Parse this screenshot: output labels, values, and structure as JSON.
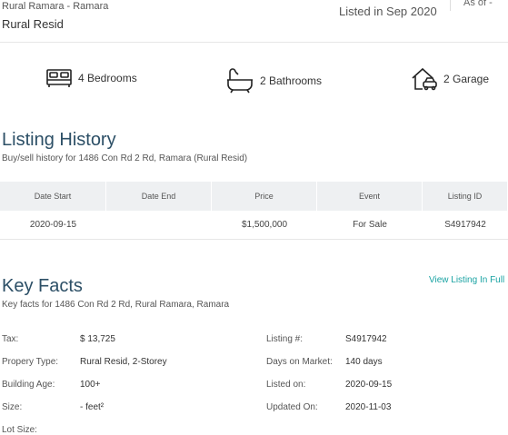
{
  "header": {
    "area": "Rural Ramara - Ramara",
    "property_type": "Rural Resid",
    "listed": "Listed in Sep 2020",
    "as_of": "As of -"
  },
  "features": {
    "bedrooms": "4 Bedrooms",
    "bathrooms": "2 Bathrooms",
    "garage": "2 Garage"
  },
  "history": {
    "title": "Listing History",
    "subtitle": "Buy/sell history for 1486 Con Rd 2 Rd, Ramara (Rural Resid)",
    "columns": [
      "Date Start",
      "Date End",
      "Price",
      "Event",
      "Listing ID"
    ],
    "rows": [
      [
        "2020-09-15",
        "",
        "$1,500,000",
        "For Sale",
        "S4917942"
      ]
    ]
  },
  "key_facts": {
    "title": "Key Facts",
    "subtitle": "Key facts for 1486 Con Rd 2 Rd, Rural Ramara, Ramara",
    "view_link": "View Listing In Full",
    "left": [
      {
        "label": "Tax:",
        "value": "$ 13,725"
      },
      {
        "label": "Propery Type:",
        "value": "Rural Resid, 2-Storey"
      },
      {
        "label": "Building Age:",
        "value": "100+"
      },
      {
        "label": "Size:",
        "value": "- feet²"
      },
      {
        "label": "Lot Size:",
        "value": ""
      }
    ],
    "right": [
      {
        "label": "Listing #:",
        "value": "S4917942"
      },
      {
        "label": "Days on Market:",
        "value": "140 days"
      },
      {
        "label": "Listed on:",
        "value": "2020-09-15"
      },
      {
        "label": "Updated On:",
        "value": "2020-11-03"
      }
    ]
  }
}
